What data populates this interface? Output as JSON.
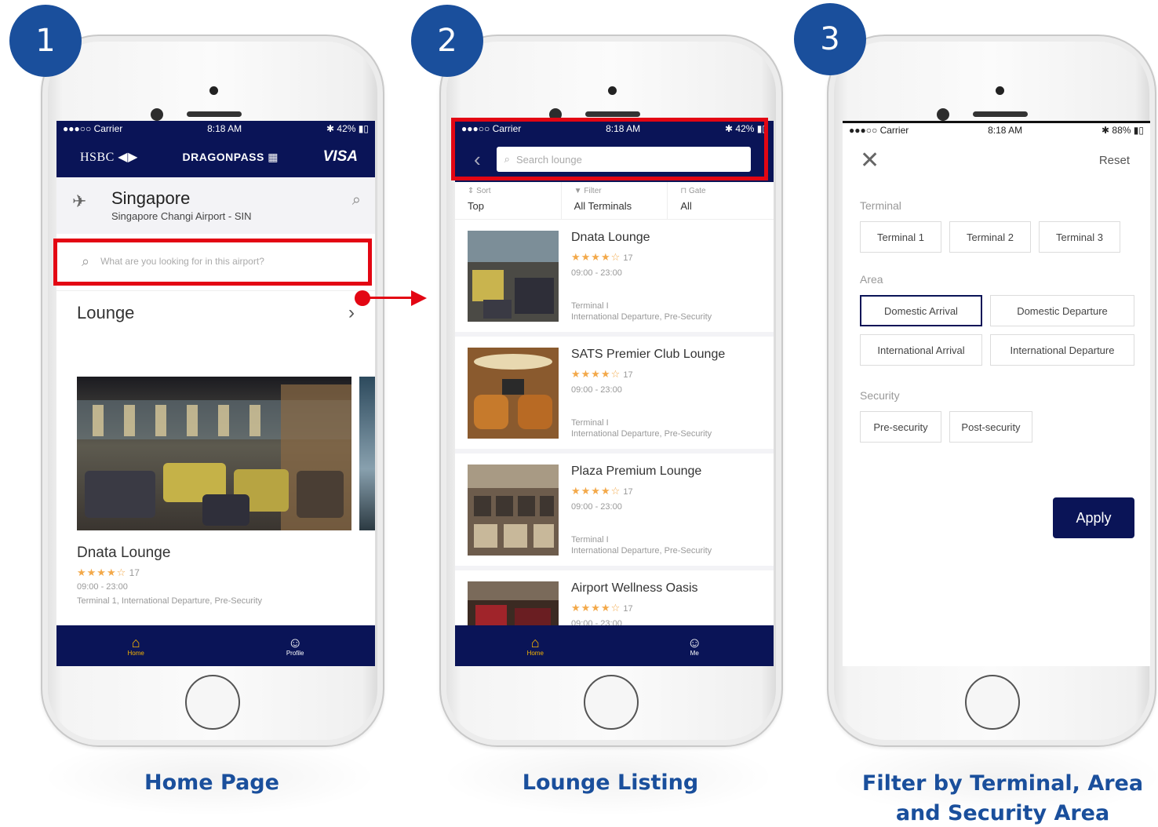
{
  "steps": [
    {
      "number": "1",
      "caption": "Home Page"
    },
    {
      "number": "2",
      "caption": "Lounge Listing"
    },
    {
      "number": "3",
      "caption_line1": "Filter by Terminal, Area",
      "caption_line2": "and Security Area"
    }
  ],
  "colors": {
    "navy": "#0a1457",
    "accent_red": "#e30613",
    "badge_blue": "#1a4f9c",
    "tab_active": "#f7b500",
    "stars": "#f3a94a"
  },
  "home": {
    "status": {
      "carrier": "●●●○○ Carrier",
      "time": "8:18 AM",
      "battery": "42%"
    },
    "brands": {
      "hsbc": "HSBC",
      "dragonpass": "DRAGONPASS",
      "visa": "VISA"
    },
    "city": "Singapore",
    "airport": "Singapore Changi Airport - SIN",
    "search_placeholder": "What are you looking for in this airport?",
    "section": "Lounge",
    "card": {
      "title": "Dnata Lounge",
      "rating": 4,
      "reviews": "17",
      "hours": "09:00 - 23:00",
      "location": "Terminal 1, International Departure, Pre-Security"
    },
    "tabs": {
      "home": "Home",
      "profile": "Profile"
    }
  },
  "listing": {
    "status": {
      "carrier": "●●●○○ Carrier",
      "time": "8:18 AM",
      "battery": "42%"
    },
    "search_placeholder": "Search lounge",
    "filters": [
      {
        "label": "Sort",
        "value": "Top",
        "icon": "sort-icon"
      },
      {
        "label": "Filter",
        "value": "All Terminals",
        "icon": "filter-icon"
      },
      {
        "label": "Gate",
        "value": "All",
        "icon": "gate-icon"
      }
    ],
    "lounges": [
      {
        "name": "Dnata Lounge",
        "rating": 4,
        "reviews": "17",
        "hours": "09:00 - 23:00",
        "terminal": "Terminal I",
        "area": "International Departure, Pre-Security"
      },
      {
        "name": "SATS Premier Club Lounge",
        "rating": 4,
        "reviews": "17",
        "hours": "09:00 - 23:00",
        "terminal": "Terminal I",
        "area": "International Departure, Pre-Security"
      },
      {
        "name": "Plaza Premium Lounge",
        "rating": 4,
        "reviews": "17",
        "hours": "09:00 - 23:00",
        "terminal": "Terminal I",
        "area": "International Departure, Pre-Security"
      },
      {
        "name": "Airport Wellness Oasis",
        "rating": 4,
        "reviews": "17",
        "hours": "09:00 - 23:00"
      }
    ],
    "tabs": {
      "home": "Home",
      "me": "Me"
    }
  },
  "filter": {
    "status": {
      "carrier": "●●●○○ Carrier",
      "time": "8:18 AM",
      "battery": "88%"
    },
    "reset": "Reset",
    "terminal_label": "Terminal",
    "terminals": [
      "Terminal 1",
      "Terminal 2",
      "Terminal 3"
    ],
    "area_label": "Area",
    "areas": [
      "Domestic Arrival",
      "Domestic Departure",
      "International Arrival",
      "International Departure"
    ],
    "area_selected": "Domestic Arrival",
    "security_label": "Security",
    "security": [
      "Pre-security",
      "Post-security"
    ],
    "apply": "Apply"
  }
}
